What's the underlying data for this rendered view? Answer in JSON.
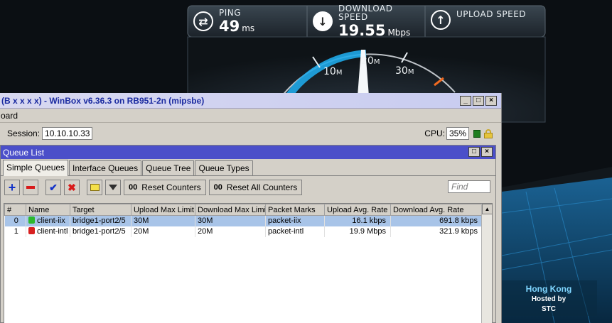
{
  "speedtest": {
    "ping": {
      "label": "PING",
      "value": "49",
      "unit": "ms"
    },
    "download": {
      "label": "DOWNLOAD SPEED",
      "value": "19.55",
      "unit": "Mbps"
    },
    "upload": {
      "label": "UPLOAD SPEED"
    },
    "gauge_ticks": [
      {
        "num": "10",
        "unit": "M"
      },
      {
        "num": "20",
        "unit": "M"
      },
      {
        "num": "30",
        "unit": "M"
      }
    ],
    "gauge_progress": 0.5,
    "location": {
      "city": "Hong Kong",
      "hosted_by": "Hosted by",
      "host": "STC"
    },
    "colors": {
      "accent": "#1fa8e8",
      "background": "#0b0f13"
    }
  },
  "winbox": {
    "title": "(B x x x x) - WinBox v6.36.3 on RB951-2n (mipsbe)",
    "menu": "oard",
    "session_label": "Session:",
    "session_value": "10.10.10.33",
    "cpu_label": "CPU:",
    "cpu_value": "35%",
    "window_buttons": [
      "_",
      "□",
      "×"
    ]
  },
  "queue_list": {
    "title": "Queue List",
    "tabs": [
      "Simple Queues",
      "Interface Queues",
      "Queue Tree",
      "Queue Types"
    ],
    "toolbar": {
      "reset_counters": "Reset Counters",
      "reset_all_counters": "Reset All Counters",
      "counter_prefix": "00",
      "find_placeholder": "Find"
    },
    "columns": [
      "#",
      "Name",
      "Target",
      "Upload Max Limit",
      "Download Max Limit",
      "Packet Marks",
      "Upload Avg. Rate",
      "Download Avg. Rate"
    ],
    "rows": [
      {
        "idx": "0",
        "name": "client-iix",
        "target": "bridge1-port2/5",
        "up_max": "30M",
        "down_max": "30M",
        "marks": "packet-iix",
        "up_avg": "16.1 kbps",
        "down_avg": "691.8 kbps",
        "icon_color": "#2db82d",
        "selected": true
      },
      {
        "idx": "1",
        "name": "client-intl",
        "target": "bridge1-port2/5",
        "up_max": "20M",
        "down_max": "20M",
        "marks": "packet-intl",
        "up_avg": "19.9 Mbps",
        "down_avg": "321.9 kbps",
        "icon_color": "#d82020",
        "selected": false
      }
    ]
  }
}
